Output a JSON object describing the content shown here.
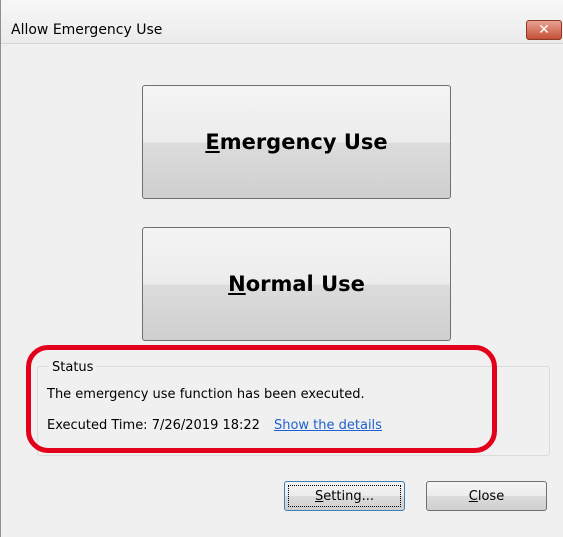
{
  "window": {
    "title": "Allow Emergency Use",
    "close_glyph": "✕"
  },
  "main": {
    "emergency_button": {
      "accel": "E",
      "rest": "mergency Use"
    },
    "normal_button": {
      "accel": "N",
      "rest": "ormal Use"
    }
  },
  "status": {
    "label": "Status",
    "message": "The emergency use function has been executed.",
    "executed_time": "Executed Time: 7/26/2019 18:22",
    "details_link": "Show the details"
  },
  "footer": {
    "setting_button": {
      "accel": "S",
      "rest": "etting..."
    },
    "close_button": {
      "accel": "C",
      "rest": "lose"
    }
  },
  "colors": {
    "highlight": "#e3001b",
    "link": "#1f5fcf",
    "close_button": "#c64f36"
  },
  "icons": {
    "close": "close-icon"
  }
}
